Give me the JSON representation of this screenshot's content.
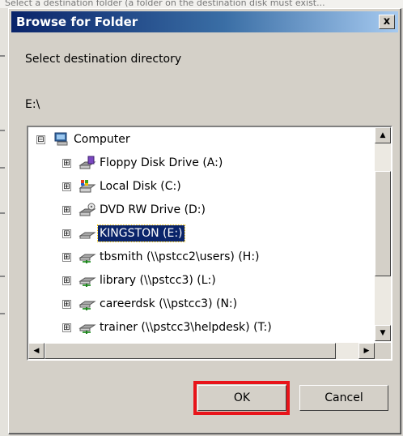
{
  "background": {
    "text": "Select a destination folder (a folder on the destination disk must exist..."
  },
  "dialog": {
    "title": "Browse for Folder",
    "close_glyph": "x",
    "prompt": "Select destination directory",
    "path": "E:\\"
  },
  "tree": {
    "items": [
      {
        "label": "Computer",
        "icon": "computer-icon",
        "expander": "⊟",
        "level": 0
      },
      {
        "label": "Floppy Disk Drive (A:)",
        "icon": "floppy-drive-icon",
        "expander": "⊞",
        "level": 1
      },
      {
        "label": "Local Disk (C:)",
        "icon": "local-disk-icon",
        "expander": "⊞",
        "level": 1
      },
      {
        "label": "DVD RW Drive (D:)",
        "icon": "dvd-drive-icon",
        "expander": "⊞",
        "level": 1
      },
      {
        "label": "KINGSTON (E:)",
        "icon": "usb-drive-icon",
        "expander": "⊞",
        "level": 1,
        "selected": true
      },
      {
        "label": "tbsmith (\\\\pstcc2\\users) (H:)",
        "icon": "network-drive-icon",
        "expander": "⊞",
        "level": 1
      },
      {
        "label": "library (\\\\pstcc3) (L:)",
        "icon": "network-drive-icon",
        "expander": "⊞",
        "level": 1
      },
      {
        "label": "careerdsk (\\\\pstcc3) (N:)",
        "icon": "network-drive-icon",
        "expander": "⊞",
        "level": 1
      },
      {
        "label": "trainer (\\\\pstcc3\\helpdesk) (T:)",
        "icon": "network-drive-icon",
        "expander": "⊞",
        "level": 1
      }
    ]
  },
  "buttons": {
    "ok": "OK",
    "cancel": "Cancel"
  },
  "colors": {
    "title_bar": "#0a246a",
    "selection": "#0a246a",
    "highlight_box": "#e8141a"
  }
}
